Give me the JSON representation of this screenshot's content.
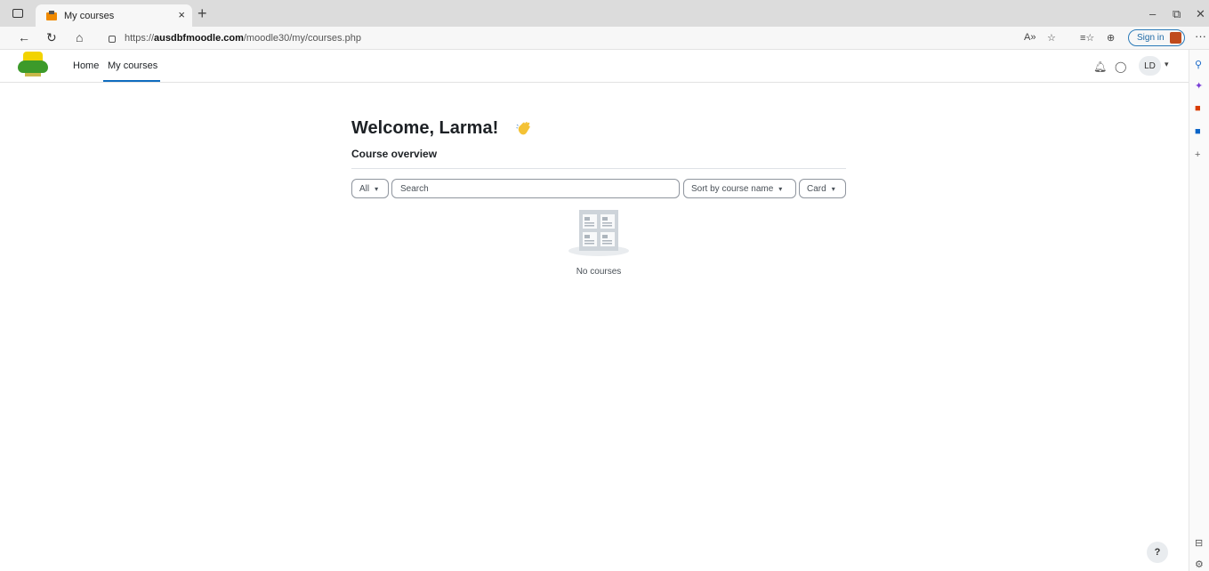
{
  "browser": {
    "tab_title": "My courses",
    "tab_close": "×",
    "new_tab": "+",
    "minimize": "–",
    "restore": "⧉",
    "close": "✕",
    "url_prefix": "https://",
    "url_host": "ausdbfmoodle.com",
    "url_path": "/moodle30/my/courses.php",
    "sign_in_label": "Sign in",
    "more_label": "···"
  },
  "navbar": {
    "home_label": "Home",
    "my_courses_label": "My courses",
    "user_initials": "LD"
  },
  "main": {
    "welcome": "Welcome, Larma!",
    "section_title": "Course overview",
    "filter_label": "All",
    "search_placeholder": "Search",
    "sort_label": "Sort by course name",
    "view_label": "Card",
    "empty_message": "No courses",
    "help_label": "?"
  },
  "colors": {
    "accent": "#0f6cbf",
    "border": "#8f959e"
  }
}
